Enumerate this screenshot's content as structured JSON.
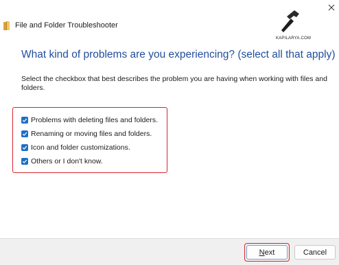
{
  "window": {
    "title": "File and Folder Troubleshooter",
    "close_icon": "close-icon"
  },
  "watermark": {
    "text": "KAPILARYA.COM"
  },
  "main": {
    "heading": "What kind of problems are you experiencing? (select all that apply)",
    "instructions": "Select the checkbox that best describes the problem you are having when working with files and folders.",
    "options": [
      {
        "label": "Problems with deleting files and folders.",
        "checked": true
      },
      {
        "label": "Renaming or moving files and folders.",
        "checked": true
      },
      {
        "label": "Icon and folder customizations.",
        "checked": true
      },
      {
        "label": "Others or I don't know.",
        "checked": true
      }
    ]
  },
  "footer": {
    "next_label": "Next",
    "cancel_label": "Cancel"
  },
  "colors": {
    "heading": "#1f4e9c",
    "checkbox": "#1f6fc4",
    "highlight": "#d8232a",
    "footer_bg": "#f0f0f0"
  }
}
